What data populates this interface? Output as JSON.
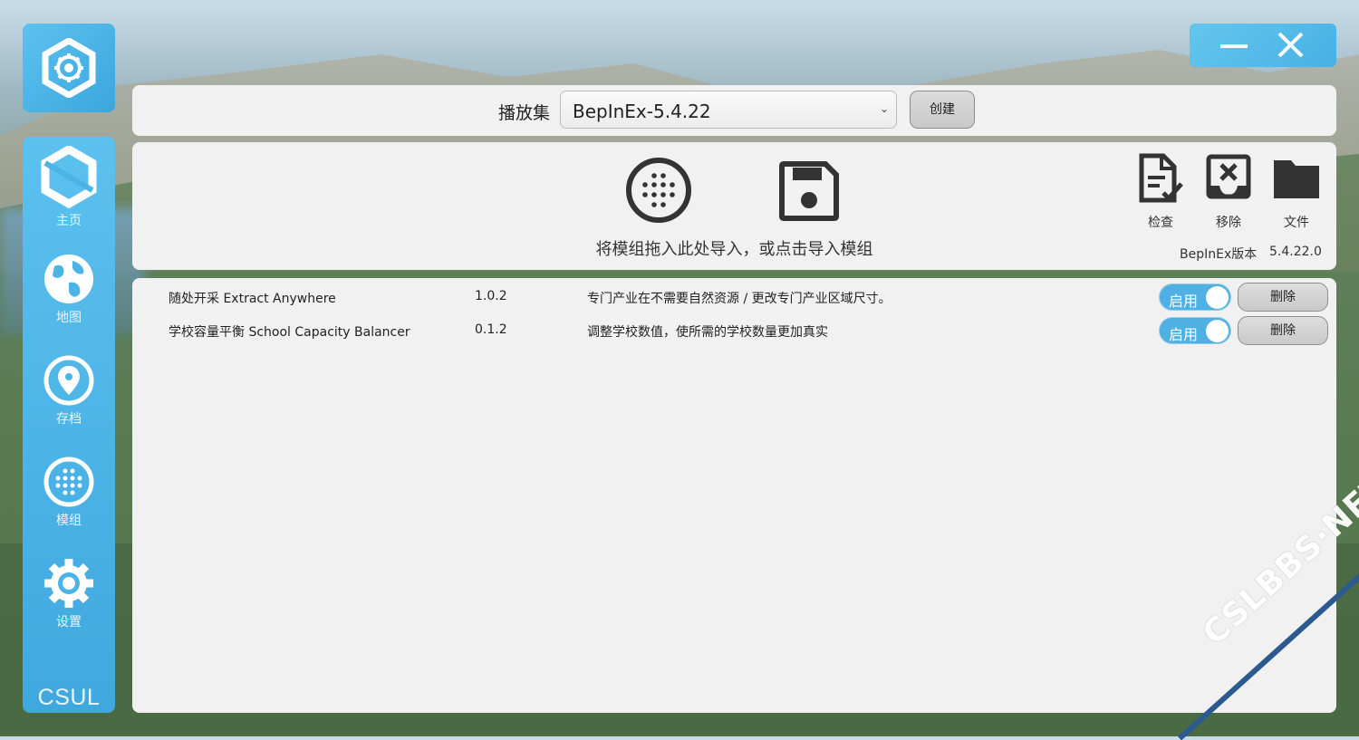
{
  "sidebar": {
    "items": [
      {
        "label": "主页",
        "icon": "home-hexagon-icon"
      },
      {
        "label": "地图",
        "icon": "globe-icon"
      },
      {
        "label": "存档",
        "icon": "location-pin-icon"
      },
      {
        "label": "模组",
        "icon": "mods-grid-icon"
      },
      {
        "label": "设置",
        "icon": "gear-icon"
      }
    ],
    "brand": "CSUL"
  },
  "window": {
    "minimize_icon": "minimize-icon",
    "close_icon": "close-icon"
  },
  "profile": {
    "label": "播放集",
    "selected": "BepInEx-5.4.22",
    "create_label": "创建"
  },
  "import": {
    "drop_text": "将模组拖入此处导入，或点击导入模组"
  },
  "tools": [
    {
      "label": "检查",
      "icon": "check-document-icon"
    },
    {
      "label": "移除",
      "icon": "remove-icon"
    },
    {
      "label": "文件",
      "icon": "folder-icon"
    }
  ],
  "bepinex": {
    "label": "BepInEx版本",
    "version": "5.4.22.0"
  },
  "mods": [
    {
      "name": "随处开采 Extract Anywhere",
      "version": "1.0.2",
      "description": "专门产业在不需要自然资源 / 更改专门产业区域尺寸。",
      "toggle_label": "启用",
      "delete_label": "删除"
    },
    {
      "name": "学校容量平衡 School Capacity Balancer",
      "version": "0.1.2",
      "description": "调整学校数值，使所需的学校数量更加真实",
      "toggle_label": "启用",
      "delete_label": "删除"
    }
  ],
  "watermark": "CSLBBS·NET",
  "colors": {
    "accent": "#4fb0e3",
    "sidebar": "#4ab4e6",
    "panel": "#f1f1f1"
  }
}
